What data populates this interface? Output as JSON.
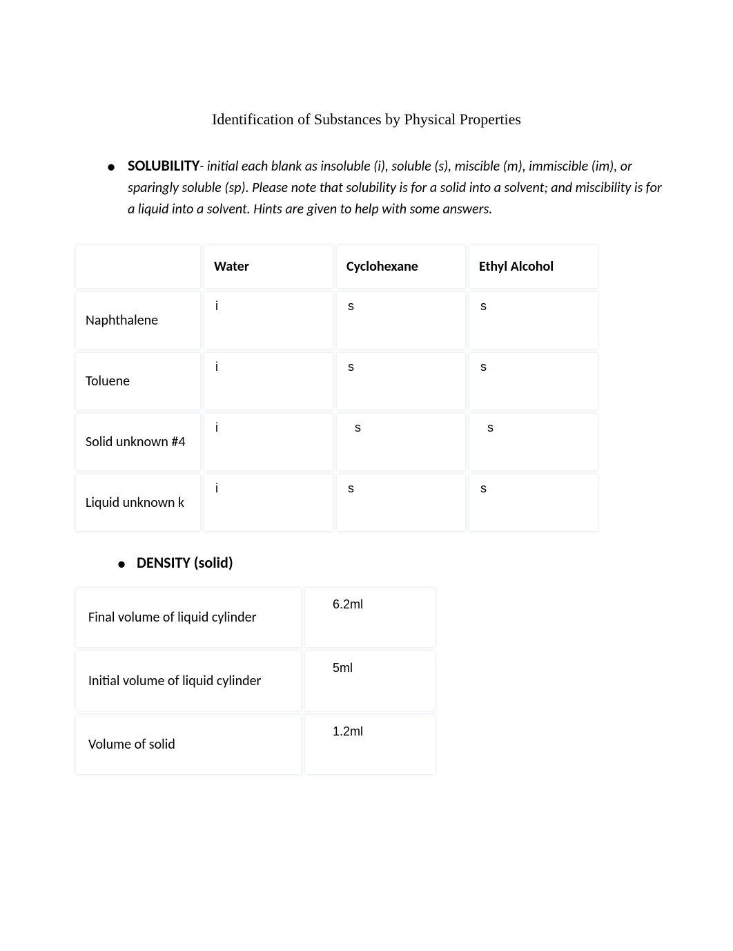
{
  "title": "Identification of Substances by Physical Properties",
  "solubility": {
    "heading": "SOLUBILITY",
    "desc1": "- initial each blank as insoluble (i), soluble (s), miscible (m), immiscible (im), or sparingly soluble (sp). Please note that solubility is for a solid into a solvent; and miscibility is for a liquid into a solvent. Hints are given to help with some answers.",
    "headers": {
      "c0": "",
      "c1": "Water",
      "c2": "Cyclohexane",
      "c3": "Ethyl Alcohol"
    },
    "rows": [
      {
        "name": "Naphthalene",
        "water": "i",
        "cyclohexane": "s",
        "ethyl": "s"
      },
      {
        "name": "Toluene",
        "water": "i",
        "cyclohexane": "s",
        "ethyl": "s"
      },
      {
        "name": "Solid unknown #4",
        "water": "i",
        "cyclohexane": "s",
        "ethyl": "s"
      },
      {
        "name": "Liquid unknown k",
        "water": "i",
        "cyclohexane": "s",
        "ethyl": "s"
      }
    ]
  },
  "density": {
    "heading": "DENSITY (solid)",
    "rows": [
      {
        "label": "Final volume of liquid cylinder",
        "value": "6.2ml"
      },
      {
        "label": "Initial volume of liquid cylinder",
        "value": "5ml"
      },
      {
        "label": "Volume of solid",
        "value": "1.2ml"
      }
    ]
  }
}
